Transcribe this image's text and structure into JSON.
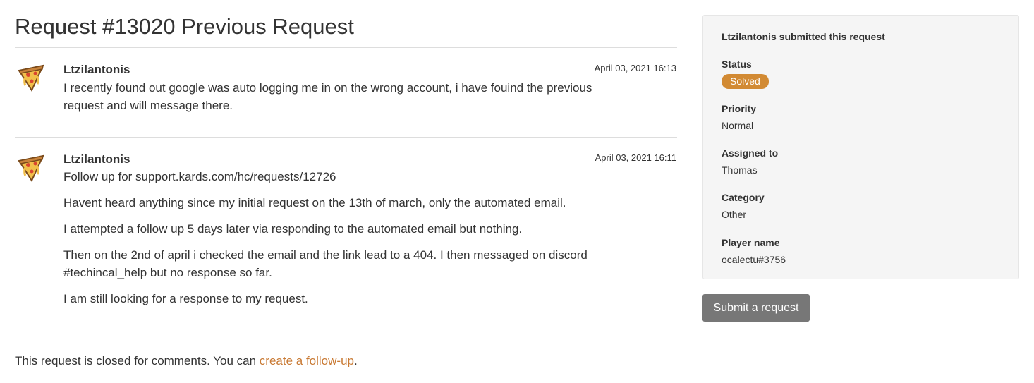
{
  "page": {
    "title": "Request #13020 Previous Request"
  },
  "comments": [
    {
      "author": "Ltzilantonis",
      "date": "April 03, 2021 16:13",
      "avatar_icon": "pizza-icon",
      "paragraphs": [
        "I recently found out google was auto logging me in on the wrong account, i have fouind the previous request and will message there."
      ]
    },
    {
      "author": "Ltzilantonis",
      "date": "April 03, 2021 16:11",
      "avatar_icon": "pizza-icon",
      "paragraphs": [
        "Follow up for support.kards.com/hc/requests/12726",
        "Havent heard anything since my initial request on the 13th of march, only the automated email.",
        "I attempted a follow up 5 days later via responding to the automated email but nothing.",
        "Then on the 2nd of april i checked the email and the link lead to a 404. I then messaged on discord #techincal_help but no response so far.",
        "I am still looking for a response to my request."
      ]
    }
  ],
  "closed_note": {
    "text": "This request is closed for comments. You can ",
    "link_label": "create a follow-up",
    "suffix": "."
  },
  "sidebar": {
    "submitter": "Ltzilantonis submitted this request",
    "status": {
      "label": "Status",
      "value": "Solved",
      "color": "#d28a33"
    },
    "priority": {
      "label": "Priority",
      "value": "Normal"
    },
    "assigned": {
      "label": "Assigned to",
      "value": "Thomas"
    },
    "category": {
      "label": "Category",
      "value": "Other"
    },
    "player": {
      "label": "Player name",
      "value": "ocalectu#3756"
    }
  },
  "actions": {
    "submit_label": "Submit a request"
  },
  "colors": {
    "link": "#c97a34",
    "button": "#777777",
    "badge": "#d28a33"
  }
}
